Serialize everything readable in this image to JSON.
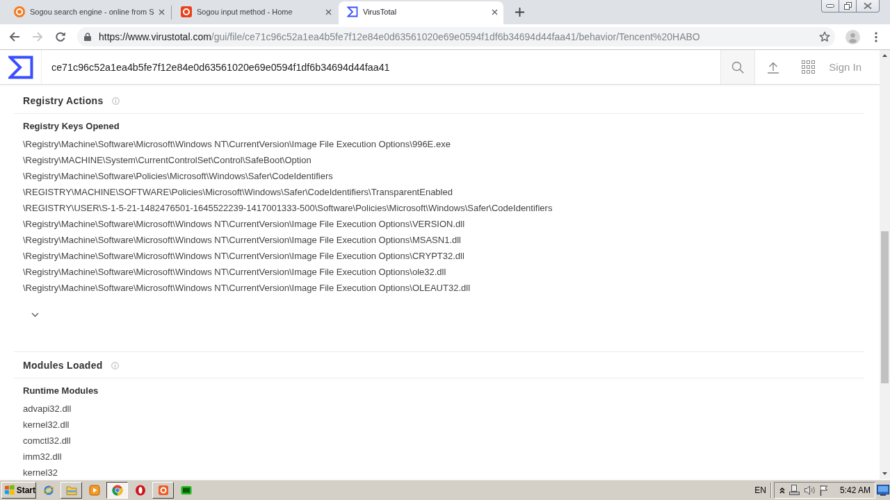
{
  "browser": {
    "tabs": [
      {
        "title": "Sogou search engine - online from S",
        "kind": "round",
        "selected": false
      },
      {
        "title": "Sogou input method - Home",
        "kind": "square",
        "selected": false
      },
      {
        "title": "VirusTotal",
        "kind": "sigma",
        "selected": true
      }
    ],
    "nav": [
      {
        "kind": "back",
        "disabled": false
      },
      {
        "kind": "forward",
        "disabled": true
      },
      {
        "kind": "reload",
        "disabled": false
      }
    ],
    "address_bar": {
      "url_host": "https://www.virustotal.com",
      "url_path": "/gui/file/ce71c96c52a1ea4b5fe7f12e84e0d63561020e69e0594f1df6b34694d44faa41/behavior/Tencent%20HABO"
    }
  },
  "header": {
    "search_value": "ce71c96c52a1ea4b5fe7f12e84e0d63561020e69e0594f1df6b34694d44faa41",
    "sign_in": "Sign In"
  },
  "sections": [
    {
      "title": "Registry Actions",
      "subsections": [
        {
          "title": "Registry Keys Opened",
          "expanded": false,
          "items": [
            "\\Registry\\Machine\\Software\\Microsoft\\Windows NT\\CurrentVersion\\Image File Execution Options\\996E.exe",
            "\\Registry\\MACHINE\\System\\CurrentControlSet\\Control\\SafeBoot\\Option",
            "\\Registry\\Machine\\Software\\Policies\\Microsoft\\Windows\\Safer\\CodeIdentifiers",
            "\\REGISTRY\\MACHINE\\SOFTWARE\\Policies\\Microsoft\\Windows\\Safer\\CodeIdentifiers\\TransparentEnabled",
            "\\REGISTRY\\USER\\S-1-5-21-1482476501-1645522239-1417001333-500\\Software\\Policies\\Microsoft\\Windows\\Safer\\CodeIdentifiers",
            "\\Registry\\Machine\\Software\\Microsoft\\Windows NT\\CurrentVersion\\Image File Execution Options\\VERSION.dll",
            "\\Registry\\Machine\\Software\\Microsoft\\Windows NT\\CurrentVersion\\Image File Execution Options\\MSASN1.dll",
            "\\Registry\\Machine\\Software\\Microsoft\\Windows NT\\CurrentVersion\\Image File Execution Options\\CRYPT32.dll",
            "\\Registry\\Machine\\Software\\Microsoft\\Windows NT\\CurrentVersion\\Image File Execution Options\\ole32.dll",
            "\\Registry\\Machine\\Software\\Microsoft\\Windows NT\\CurrentVersion\\Image File Execution Options\\OLEAUT32.dll"
          ]
        }
      ]
    },
    {
      "title": "Modules Loaded",
      "subsections": [
        {
          "title": "Runtime Modules",
          "items": [
            "advapi32.dll",
            "kernel32.dll",
            "comctl32.dll",
            "imm32.dll",
            "kernel32"
          ]
        }
      ]
    }
  ],
  "taskbar": {
    "start": "Start",
    "apps": [
      {
        "kind": "orbit",
        "running": false,
        "selected": false
      },
      {
        "kind": "folder",
        "running": true,
        "selected": false
      },
      {
        "kind": "play",
        "running": false,
        "selected": false
      },
      {
        "kind": "segmented",
        "running": true,
        "selected": true
      },
      {
        "kind": "ring",
        "running": false,
        "selected": false
      },
      {
        "kind": "tile",
        "running": true,
        "selected": false
      },
      {
        "kind": "tv",
        "running": false,
        "selected": false
      }
    ],
    "language": "EN",
    "clock": "5:42 AM"
  }
}
